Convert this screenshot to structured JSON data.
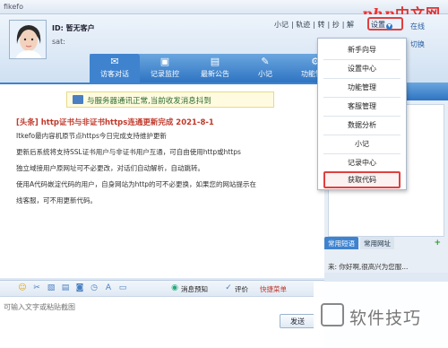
{
  "window": {
    "app_name": "fikefo"
  },
  "watermark_top": {
    "part1": "php",
    "part2": "中文网"
  },
  "user": {
    "id_label": "ID: 暂无客户",
    "subline": "sat:"
  },
  "top_links": {
    "items": [
      "小记",
      "轨迹",
      "转",
      "抄",
      "解"
    ],
    "settings_label": "设置"
  },
  "right_labels": {
    "a": "在线",
    "b": "切换"
  },
  "nav_tabs": [
    {
      "label": "访客对话",
      "icon": "chat-icon"
    },
    {
      "label": "记录监控",
      "icon": "monitor-icon"
    },
    {
      "label": "最新公告",
      "icon": "notice-icon"
    },
    {
      "label": "小记",
      "icon": "note-icon"
    },
    {
      "label": "功能管理",
      "icon": "gear-icon"
    }
  ],
  "status": {
    "text": "与服务器通讯正常,当前收发消息抖到"
  },
  "headline": "[头条] http证书与非证书https连通更新完成  2021-8-1",
  "paragraphs": [
    "Itkefo最内容机原节点https今日完成支持维护更新",
    "更新后系统将支持SSL证书用户与非证书用户互通，可自由使用http或https",
    "独立域接用户原网址可不必更改，对话们自动解析，自动跳转。",
    "使用A代码嵌淀代码的用户，自身网站为http的可不必更换，如果您的网站提示在",
    "线客服，可不用更新代码。"
  ],
  "menu": {
    "items": [
      "新手向导",
      "设置中心",
      "功能管理",
      "客服管理",
      "数据分析",
      "小记",
      "记录中心",
      "获取代码"
    ],
    "highlighted": "获取代码"
  },
  "right_panel": {
    "tab1": "常用短语",
    "tab2": "常用网址",
    "plus": "+",
    "msg": "来: 你好啊,很高兴为您服..."
  },
  "toolbar": {
    "quick_reply": "消息预知",
    "transfer": "评价",
    "quick_menu": "快捷菜单"
  },
  "input": {
    "placeholder": "可输入文字或粘贴截图"
  },
  "send": {
    "label": "发送"
  },
  "watermark_bottom": {
    "text": "软件技巧"
  },
  "colors": {
    "accent": "#3f83cf",
    "highlight": "#e04040"
  }
}
